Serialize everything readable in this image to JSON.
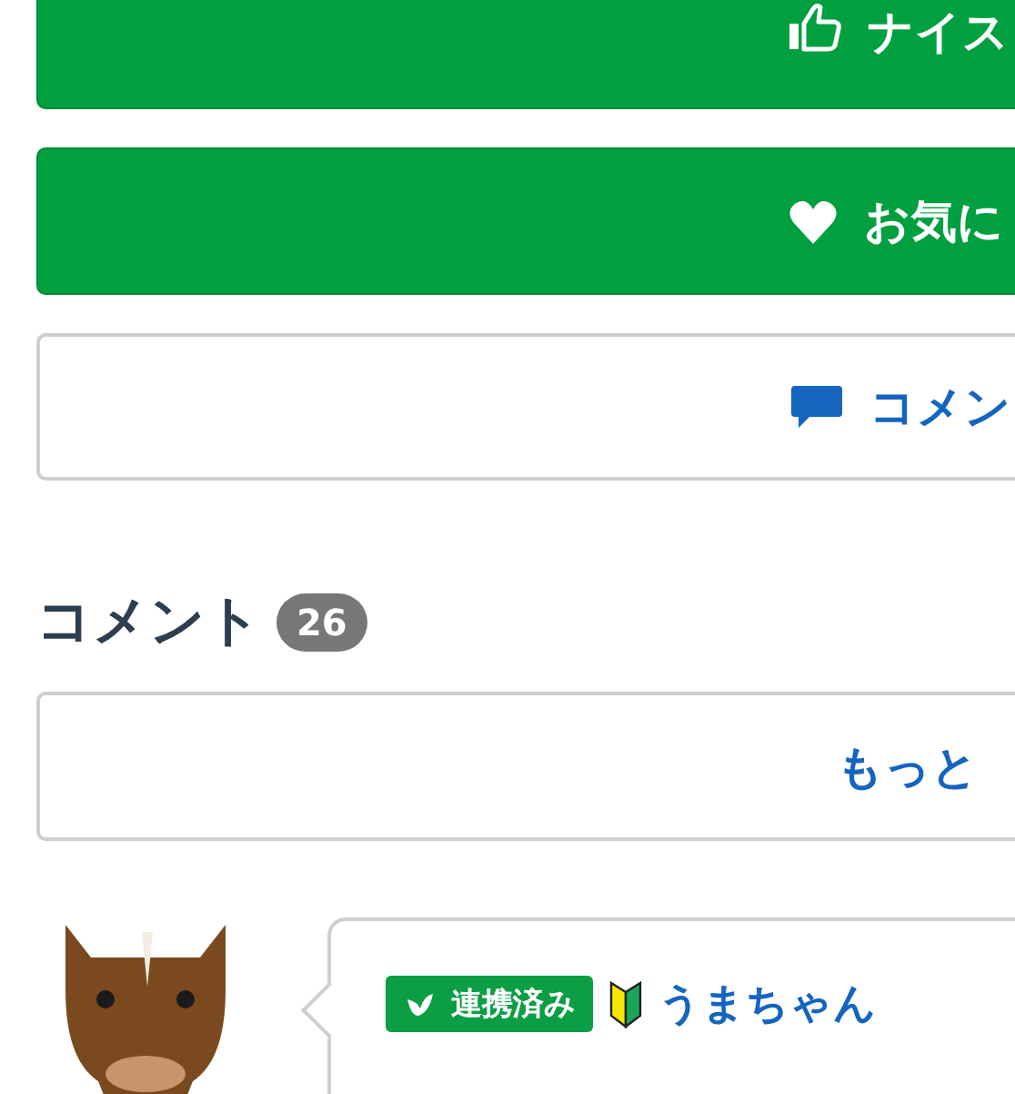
{
  "action_buttons": [
    {
      "kind": "thumb",
      "label": "ナイス"
    },
    {
      "kind": "heart",
      "label": "お気に"
    },
    {
      "kind": "speech",
      "label": "コメン"
    }
  ],
  "comments_section": {
    "heading": "コメント",
    "count": "26",
    "more_button": "もっと",
    "comments": [
      {
        "badge": "連携済み",
        "beginner": true,
        "author": "うまちゃん"
      }
    ]
  }
}
